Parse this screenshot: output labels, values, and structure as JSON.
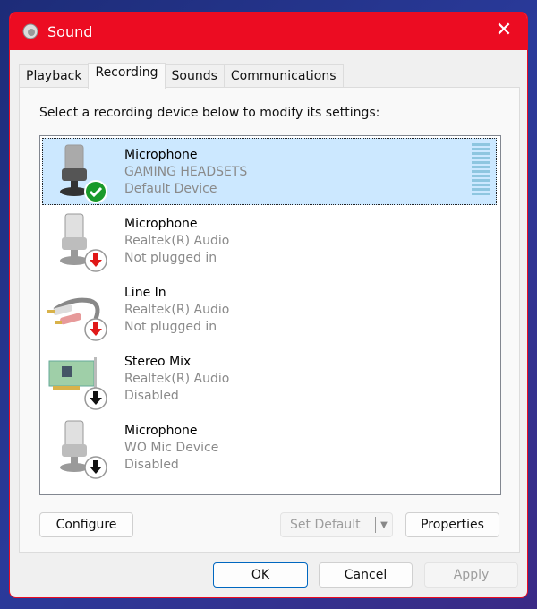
{
  "window": {
    "title": "Sound",
    "icon": "speaker-icon",
    "close_icon": "close-icon",
    "accent": "#ec0c22"
  },
  "tabs": [
    {
      "label": "Playback"
    },
    {
      "label": "Recording",
      "active": true
    },
    {
      "label": "Sounds"
    },
    {
      "label": "Communications"
    }
  ],
  "instruction": "Select a recording device below to modify its settings:",
  "devices": [
    {
      "name": "Microphone",
      "driver": "GAMING HEADSETS",
      "status": "Default Device",
      "icon": "microphone-icon",
      "badge": "check",
      "selected": true,
      "dark": true
    },
    {
      "name": "Microphone",
      "driver": "Realtek(R) Audio",
      "status": "Not plugged in",
      "icon": "microphone-icon",
      "badge": "red-down"
    },
    {
      "name": "Line In",
      "driver": "Realtek(R) Audio",
      "status": "Not plugged in",
      "icon": "line-in-cable-icon",
      "badge": "red-down"
    },
    {
      "name": "Stereo Mix",
      "driver": "Realtek(R) Audio",
      "status": "Disabled",
      "icon": "sound-card-icon",
      "badge": "black-down"
    },
    {
      "name": "Microphone",
      "driver": "WO Mic Device",
      "status": "Disabled",
      "icon": "microphone-icon",
      "badge": "black-down"
    }
  ],
  "buttons": {
    "configure": "Configure",
    "set_default": "Set Default",
    "properties": "Properties",
    "ok": "OK",
    "cancel": "Cancel",
    "apply": "Apply"
  }
}
